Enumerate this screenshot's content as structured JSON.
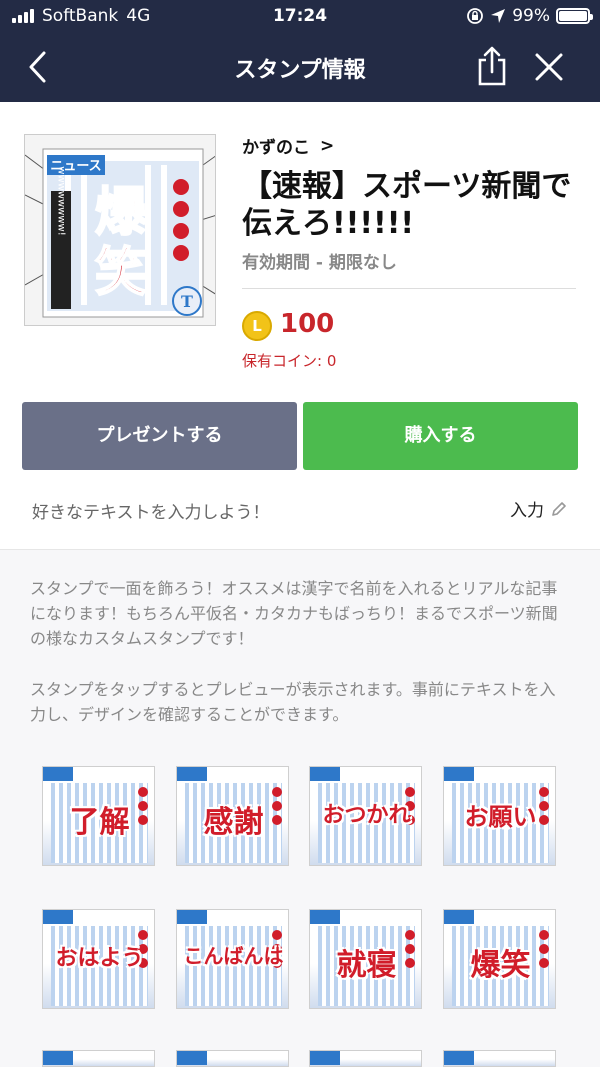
{
  "status_bar": {
    "carrier": "SoftBank",
    "network": "4G",
    "time": "17:24",
    "battery": "99%",
    "battery_level": 0.99
  },
  "nav": {
    "title": "スタンプ情報",
    "back_icon": "chevron-left-icon",
    "share_icon": "share-icon",
    "close_icon": "close-icon"
  },
  "product": {
    "author": "かずのこ",
    "author_chevron": ">",
    "title": "【速報】スポーツ新聞で伝えろ!!!!!!",
    "validity": "有効期間 - 期限なし",
    "coin_symbol": "L",
    "price": "100",
    "owned_coins": "保有コイン: 0",
    "thumb_word": "爆笑"
  },
  "actions": {
    "gift_label": "プレゼントする",
    "buy_label": "購入する"
  },
  "custom_text": {
    "hint": "好きなテキストを入力しよう！",
    "input_label": "入力"
  },
  "description": {
    "paragraph1": "スタンプで一面を飾ろう！オススメは漢字で名前を入れるとリアルな記事になります！もちろん平仮名・カタカナもばっちり！まるでスポーツ新聞の様なカスタムスタンプです！",
    "paragraph2": "スタンプをタップするとプレビューが表示されます。事前にテキストを入力し、デザインを確認することができます。"
  },
  "stickers": [
    {
      "word": "了解"
    },
    {
      "word": "感謝"
    },
    {
      "word": "おつかれ"
    },
    {
      "word": "お願い"
    },
    {
      "word": "おはよう"
    },
    {
      "word": "こんばんは"
    },
    {
      "word": "就寝"
    },
    {
      "word": "爆笑"
    }
  ],
  "colors": {
    "nav_bg": "#232b45",
    "buy_green": "#4cbb4e",
    "gift_gray": "#6a7088",
    "price_red": "#c8262b"
  }
}
